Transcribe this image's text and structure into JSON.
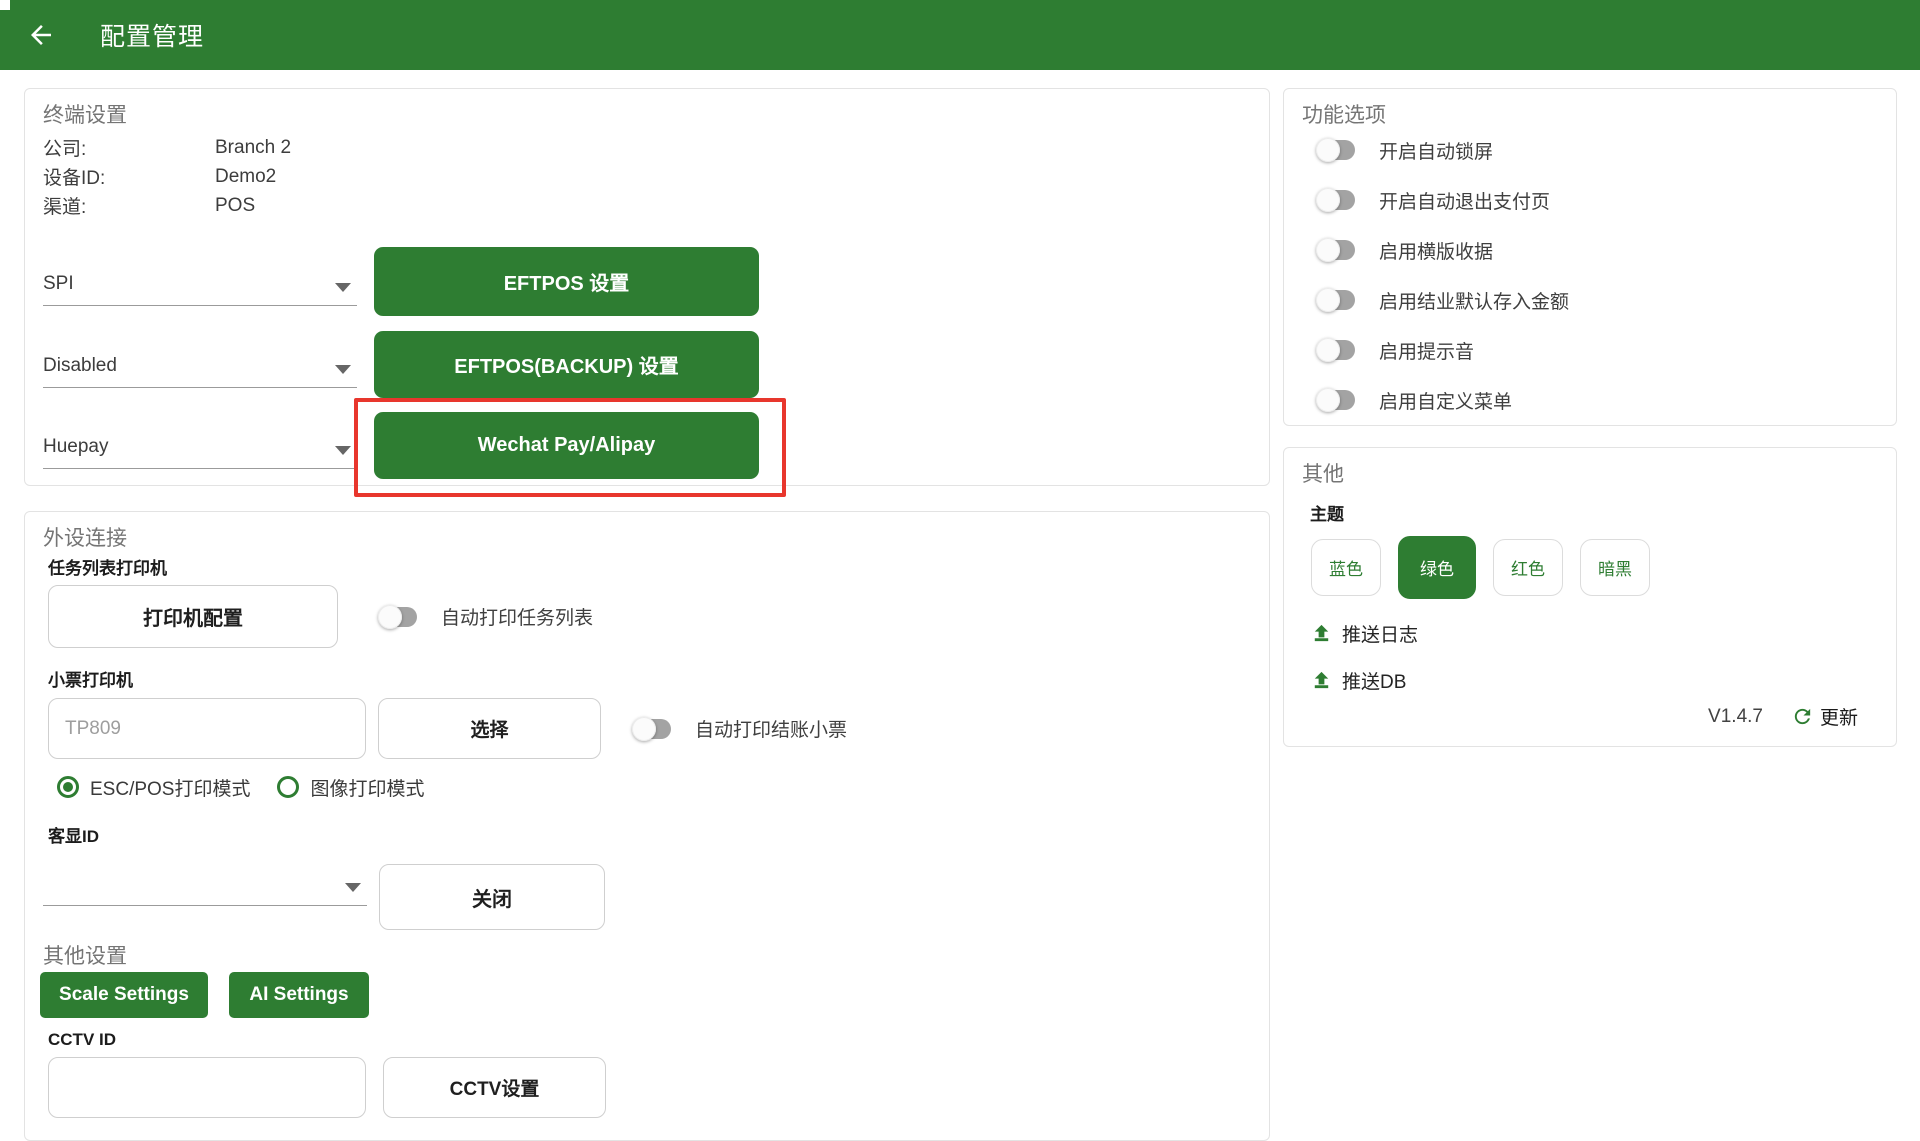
{
  "header": {
    "title": "配置管理"
  },
  "terminal_card": {
    "title": "终端设置",
    "info": [
      {
        "label": "公司:",
        "value": "Branch 2"
      },
      {
        "label": "设备ID:",
        "value": "Demo2"
      },
      {
        "label": "渠道:",
        "value": "POS"
      }
    ],
    "rows": [
      {
        "dropdown": "SPI",
        "button": "EFTPOS 设置"
      },
      {
        "dropdown": "Disabled",
        "button": "EFTPOS(BACKUP) 设置"
      },
      {
        "dropdown": "Huepay",
        "button": "Wechat Pay/Alipay"
      }
    ]
  },
  "peripheral_card": {
    "title": "外设连接",
    "job_printer": {
      "label": "任务列表打印机",
      "config_button": "打印机配置",
      "toggle_label": "自动打印任务列表",
      "toggle_on": false
    },
    "receipt_printer": {
      "label": "小票打印机",
      "placeholder": "TP809",
      "select_button": "选择",
      "toggle_label": "自动打印结账小票",
      "toggle_on": false,
      "modes": [
        {
          "label": "ESC/POS打印模式",
          "selected": true
        },
        {
          "label": "图像打印模式",
          "selected": false
        }
      ]
    },
    "customer_display": {
      "label": "客显ID",
      "dropdown_value": "",
      "close_button": "关闭"
    },
    "other_settings": {
      "title": "其他设置",
      "scale_button": "Scale Settings",
      "ai_button": "AI Settings"
    },
    "cctv": {
      "label": "CCTV ID",
      "input_value": "",
      "button": "CCTV设置"
    }
  },
  "feature_card": {
    "title": "功能选项",
    "toggles": [
      {
        "label": "开启自动锁屏",
        "on": false
      },
      {
        "label": "开启自动退出支付页",
        "on": false
      },
      {
        "label": "启用横版收据",
        "on": false
      },
      {
        "label": "启用结业默认存入金额",
        "on": false
      },
      {
        "label": "启用提示音",
        "on": false
      },
      {
        "label": "启用自定义菜单",
        "on": false
      }
    ]
  },
  "other_card": {
    "title": "其他",
    "theme": {
      "label": "主题",
      "options": [
        {
          "label": "蓝色",
          "selected": false
        },
        {
          "label": "绿色",
          "selected": true
        },
        {
          "label": "红色",
          "selected": false
        },
        {
          "label": "暗黑",
          "selected": false
        }
      ]
    },
    "push_log": "推送日志",
    "push_db": "推送DB",
    "version": "V1.4.7",
    "update": "更新"
  },
  "colors": {
    "accent_green": "#2e7d32",
    "highlight_red": "#e8362d"
  }
}
